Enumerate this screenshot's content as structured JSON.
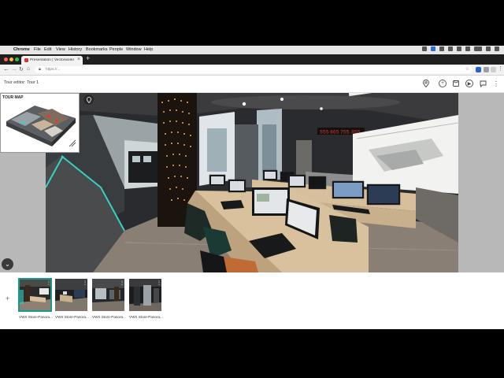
{
  "menubar": {
    "app_name": "Chrome",
    "items": [
      "File",
      "Edit",
      "View",
      "History",
      "Bookmarks",
      "People",
      "Window",
      "Help"
    ]
  },
  "browser": {
    "tab_title": "Presentation | Vectorworks Cl...",
    "tab_close": "×",
    "new_tab": "+",
    "url": "https://..."
  },
  "app": {
    "title": "Tour editor: Tour 1",
    "tour_map_label": "TOUR MAP",
    "add_label": "+",
    "thumbnails": [
      {
        "label": "VWX Store-Panora...",
        "selected": true
      },
      {
        "label": "VWX Store-Panora...",
        "selected": false
      },
      {
        "label": "VWX Store-Panora...",
        "selected": false
      },
      {
        "label": "VWX Store-Panora...",
        "selected": false
      }
    ],
    "wall_display_digits": [
      "555",
      "865",
      "755",
      "855"
    ]
  },
  "colors": {
    "accent": "#1a9a8e",
    "ticker_red": "#e53a2f",
    "led_amber": "#f4a64a",
    "teal_light": "#36d1c0"
  }
}
